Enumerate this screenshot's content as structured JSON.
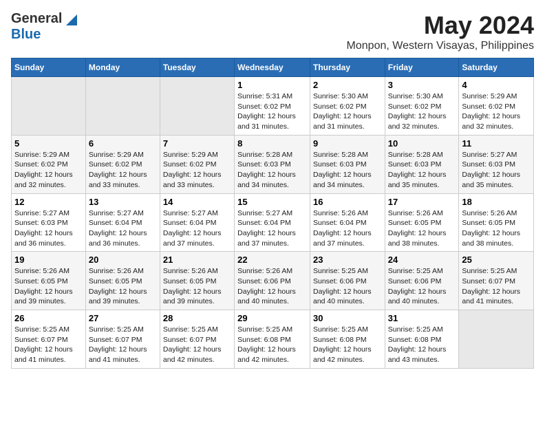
{
  "logo": {
    "general": "General",
    "blue": "Blue"
  },
  "title": "May 2024",
  "subtitle": "Monpon, Western Visayas, Philippines",
  "header_days": [
    "Sunday",
    "Monday",
    "Tuesday",
    "Wednesday",
    "Thursday",
    "Friday",
    "Saturday"
  ],
  "weeks": [
    [
      {
        "day": "",
        "sunrise": "",
        "sunset": "",
        "daylight": ""
      },
      {
        "day": "",
        "sunrise": "",
        "sunset": "",
        "daylight": ""
      },
      {
        "day": "",
        "sunrise": "",
        "sunset": "",
        "daylight": ""
      },
      {
        "day": "1",
        "sunrise": "Sunrise: 5:31 AM",
        "sunset": "Sunset: 6:02 PM",
        "daylight": "Daylight: 12 hours and 31 minutes."
      },
      {
        "day": "2",
        "sunrise": "Sunrise: 5:30 AM",
        "sunset": "Sunset: 6:02 PM",
        "daylight": "Daylight: 12 hours and 31 minutes."
      },
      {
        "day": "3",
        "sunrise": "Sunrise: 5:30 AM",
        "sunset": "Sunset: 6:02 PM",
        "daylight": "Daylight: 12 hours and 32 minutes."
      },
      {
        "day": "4",
        "sunrise": "Sunrise: 5:29 AM",
        "sunset": "Sunset: 6:02 PM",
        "daylight": "Daylight: 12 hours and 32 minutes."
      }
    ],
    [
      {
        "day": "5",
        "sunrise": "Sunrise: 5:29 AM",
        "sunset": "Sunset: 6:02 PM",
        "daylight": "Daylight: 12 hours and 32 minutes."
      },
      {
        "day": "6",
        "sunrise": "Sunrise: 5:29 AM",
        "sunset": "Sunset: 6:02 PM",
        "daylight": "Daylight: 12 hours and 33 minutes."
      },
      {
        "day": "7",
        "sunrise": "Sunrise: 5:29 AM",
        "sunset": "Sunset: 6:02 PM",
        "daylight": "Daylight: 12 hours and 33 minutes."
      },
      {
        "day": "8",
        "sunrise": "Sunrise: 5:28 AM",
        "sunset": "Sunset: 6:03 PM",
        "daylight": "Daylight: 12 hours and 34 minutes."
      },
      {
        "day": "9",
        "sunrise": "Sunrise: 5:28 AM",
        "sunset": "Sunset: 6:03 PM",
        "daylight": "Daylight: 12 hours and 34 minutes."
      },
      {
        "day": "10",
        "sunrise": "Sunrise: 5:28 AM",
        "sunset": "Sunset: 6:03 PM",
        "daylight": "Daylight: 12 hours and 35 minutes."
      },
      {
        "day": "11",
        "sunrise": "Sunrise: 5:27 AM",
        "sunset": "Sunset: 6:03 PM",
        "daylight": "Daylight: 12 hours and 35 minutes."
      }
    ],
    [
      {
        "day": "12",
        "sunrise": "Sunrise: 5:27 AM",
        "sunset": "Sunset: 6:03 PM",
        "daylight": "Daylight: 12 hours and 36 minutes."
      },
      {
        "day": "13",
        "sunrise": "Sunrise: 5:27 AM",
        "sunset": "Sunset: 6:04 PM",
        "daylight": "Daylight: 12 hours and 36 minutes."
      },
      {
        "day": "14",
        "sunrise": "Sunrise: 5:27 AM",
        "sunset": "Sunset: 6:04 PM",
        "daylight": "Daylight: 12 hours and 37 minutes."
      },
      {
        "day": "15",
        "sunrise": "Sunrise: 5:27 AM",
        "sunset": "Sunset: 6:04 PM",
        "daylight": "Daylight: 12 hours and 37 minutes."
      },
      {
        "day": "16",
        "sunrise": "Sunrise: 5:26 AM",
        "sunset": "Sunset: 6:04 PM",
        "daylight": "Daylight: 12 hours and 37 minutes."
      },
      {
        "day": "17",
        "sunrise": "Sunrise: 5:26 AM",
        "sunset": "Sunset: 6:05 PM",
        "daylight": "Daylight: 12 hours and 38 minutes."
      },
      {
        "day": "18",
        "sunrise": "Sunrise: 5:26 AM",
        "sunset": "Sunset: 6:05 PM",
        "daylight": "Daylight: 12 hours and 38 minutes."
      }
    ],
    [
      {
        "day": "19",
        "sunrise": "Sunrise: 5:26 AM",
        "sunset": "Sunset: 6:05 PM",
        "daylight": "Daylight: 12 hours and 39 minutes."
      },
      {
        "day": "20",
        "sunrise": "Sunrise: 5:26 AM",
        "sunset": "Sunset: 6:05 PM",
        "daylight": "Daylight: 12 hours and 39 minutes."
      },
      {
        "day": "21",
        "sunrise": "Sunrise: 5:26 AM",
        "sunset": "Sunset: 6:05 PM",
        "daylight": "Daylight: 12 hours and 39 minutes."
      },
      {
        "day": "22",
        "sunrise": "Sunrise: 5:26 AM",
        "sunset": "Sunset: 6:06 PM",
        "daylight": "Daylight: 12 hours and 40 minutes."
      },
      {
        "day": "23",
        "sunrise": "Sunrise: 5:25 AM",
        "sunset": "Sunset: 6:06 PM",
        "daylight": "Daylight: 12 hours and 40 minutes."
      },
      {
        "day": "24",
        "sunrise": "Sunrise: 5:25 AM",
        "sunset": "Sunset: 6:06 PM",
        "daylight": "Daylight: 12 hours and 40 minutes."
      },
      {
        "day": "25",
        "sunrise": "Sunrise: 5:25 AM",
        "sunset": "Sunset: 6:07 PM",
        "daylight": "Daylight: 12 hours and 41 minutes."
      }
    ],
    [
      {
        "day": "26",
        "sunrise": "Sunrise: 5:25 AM",
        "sunset": "Sunset: 6:07 PM",
        "daylight": "Daylight: 12 hours and 41 minutes."
      },
      {
        "day": "27",
        "sunrise": "Sunrise: 5:25 AM",
        "sunset": "Sunset: 6:07 PM",
        "daylight": "Daylight: 12 hours and 41 minutes."
      },
      {
        "day": "28",
        "sunrise": "Sunrise: 5:25 AM",
        "sunset": "Sunset: 6:07 PM",
        "daylight": "Daylight: 12 hours and 42 minutes."
      },
      {
        "day": "29",
        "sunrise": "Sunrise: 5:25 AM",
        "sunset": "Sunset: 6:08 PM",
        "daylight": "Daylight: 12 hours and 42 minutes."
      },
      {
        "day": "30",
        "sunrise": "Sunrise: 5:25 AM",
        "sunset": "Sunset: 6:08 PM",
        "daylight": "Daylight: 12 hours and 42 minutes."
      },
      {
        "day": "31",
        "sunrise": "Sunrise: 5:25 AM",
        "sunset": "Sunset: 6:08 PM",
        "daylight": "Daylight: 12 hours and 43 minutes."
      },
      {
        "day": "",
        "sunrise": "",
        "sunset": "",
        "daylight": ""
      }
    ]
  ]
}
